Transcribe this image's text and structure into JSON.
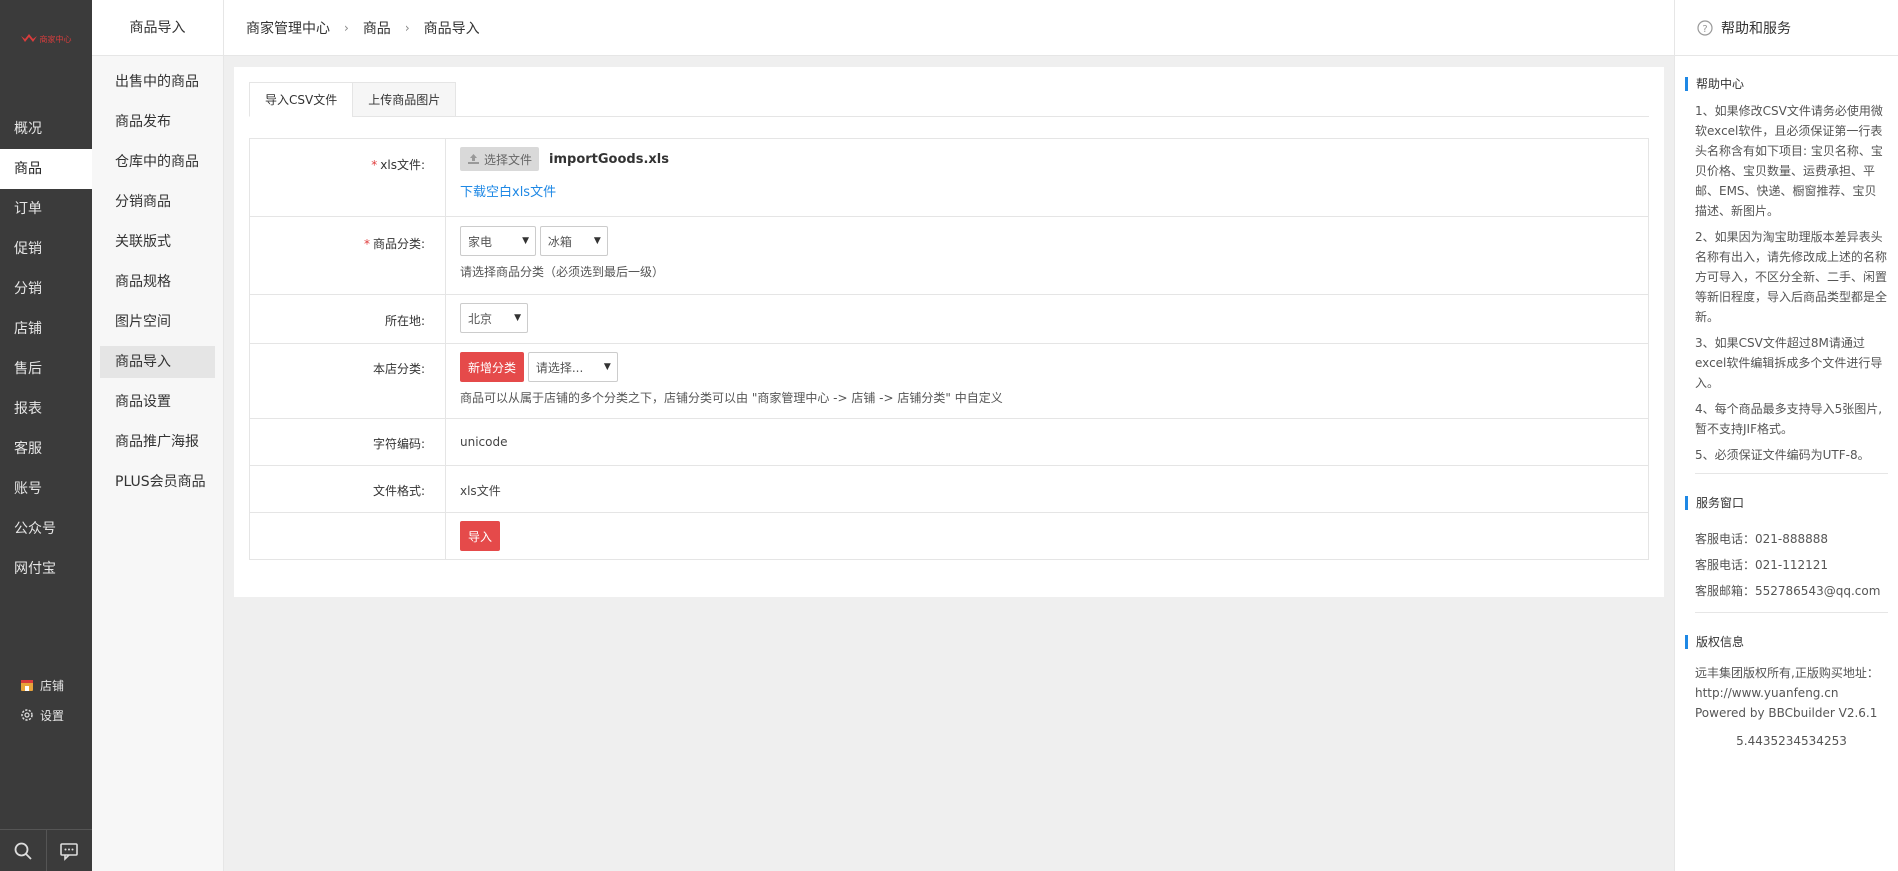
{
  "logo": {
    "text": "商家中心",
    "color": "#d93c3c"
  },
  "left_nav": {
    "items": [
      {
        "label": "概况",
        "active": false
      },
      {
        "label": "商品",
        "active": true
      },
      {
        "label": "订单",
        "active": false
      },
      {
        "label": "促销",
        "active": false
      },
      {
        "label": "分销",
        "active": false
      },
      {
        "label": "店铺",
        "active": false
      },
      {
        "label": "售后",
        "active": false
      },
      {
        "label": "报表",
        "active": false
      },
      {
        "label": "客服",
        "active": false
      },
      {
        "label": "账号",
        "active": false
      },
      {
        "label": "公众号",
        "active": false
      },
      {
        "label": "网付宝",
        "active": false
      }
    ],
    "bottom": {
      "shop_label": "店铺",
      "settings_label": "设置"
    },
    "footer": {
      "search_icon": "search-icon",
      "chat_icon": "chat-icon"
    }
  },
  "sub_nav": {
    "title": "商品导入",
    "items": [
      {
        "label": "出售中的商品",
        "active": false
      },
      {
        "label": "商品发布",
        "active": false
      },
      {
        "label": "仓库中的商品",
        "active": false
      },
      {
        "label": "分销商品",
        "active": false
      },
      {
        "label": "关联版式",
        "active": false
      },
      {
        "label": "商品规格",
        "active": false
      },
      {
        "label": "图片空间",
        "active": false
      },
      {
        "label": "商品导入",
        "active": true
      },
      {
        "label": "商品设置",
        "active": false
      },
      {
        "label": "商品推广海报",
        "active": false
      },
      {
        "label": "PLUS会员商品",
        "active": false
      }
    ]
  },
  "breadcrumb": {
    "items": [
      "商家管理中心",
      "商品",
      "商品导入"
    ],
    "separator": "›"
  },
  "tabs": [
    {
      "label": "导入CSV文件",
      "active": true
    },
    {
      "label": "上传商品图片",
      "active": false
    }
  ],
  "form": {
    "xls": {
      "required_mark": "*",
      "label": "xls文件:",
      "choose_button": "选择文件",
      "file_name": "importGoods.xls",
      "download_link": "下载空白xls文件"
    },
    "category": {
      "required_mark": "*",
      "label": "商品分类:",
      "select1": "家电",
      "select2": "冰箱",
      "hint": "请选择商品分类（必须选到最后一级）"
    },
    "location": {
      "label": "所在地:",
      "select": "北京"
    },
    "shop_category": {
      "label": "本店分类:",
      "add_button": "新增分类",
      "select": "请选择...",
      "hint": "商品可以从属于店铺的多个分类之下，店铺分类可以由 \"商家管理中心 -> 店铺 -> 店铺分类\" 中自定义"
    },
    "encoding": {
      "label": "字符编码:",
      "value": "unicode"
    },
    "format": {
      "label": "文件格式:",
      "value": "xls文件"
    },
    "submit_button": "导入"
  },
  "help": {
    "title": "帮助和服务",
    "center_title": "帮助中心",
    "center_items": [
      "1、如果修改CSV文件请务必使用微软excel软件，且必须保证第一行表头名称含有如下项目: 宝贝名称、宝贝价格、宝贝数量、运费承担、平邮、EMS、快递、橱窗推荐、宝贝描述、新图片。",
      "2、如果因为淘宝助理版本差异表头名称有出入，请先修改成上述的名称方可导入，不区分全新、二手、闲置等新旧程度，导入后商品类型都是全新。",
      "3、如果CSV文件超过8M请通过excel软件编辑拆成多个文件进行导入。",
      "4、每个商品最多支持导入5张图片,暂不支持JIF格式。",
      "5、必须保证文件编码为UTF-8。"
    ],
    "service_title": "服务窗口",
    "service_items": [
      "客服电话：021-888888",
      "客服电话：021-112121",
      "客服邮箱：552786543@qq.com"
    ],
    "copyright_title": "版权信息",
    "copyright_text": "远丰集团版权所有,正版购买地址：http://www.yuanfeng.cn",
    "powered_by": "Powered by BBCbuilder V2.6.1",
    "version_number": "5.4435234534253"
  },
  "colors": {
    "accent_red": "#e54a4a",
    "link_blue": "#1e88e5",
    "nav_dark": "#3b3b3b"
  }
}
